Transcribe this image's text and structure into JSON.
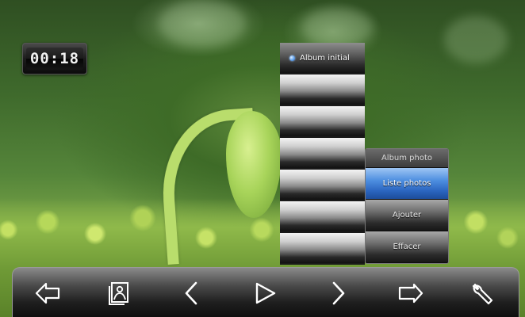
{
  "timer": {
    "display": "00:18"
  },
  "album_menu": {
    "items": [
      {
        "label": "Album initial",
        "selected": true
      },
      {
        "label": ""
      },
      {
        "label": ""
      },
      {
        "label": ""
      },
      {
        "label": ""
      },
      {
        "label": ""
      },
      {
        "label": ""
      }
    ]
  },
  "photo_menu": {
    "header": "Album photo",
    "options": [
      {
        "label": "Liste photos",
        "selected": true
      },
      {
        "label": "Ajouter"
      },
      {
        "label": "Effacer"
      }
    ]
  },
  "toolbar": {
    "buttons": [
      {
        "name": "back",
        "icon": "back-arrow-icon"
      },
      {
        "name": "photo-album",
        "icon": "photo-frame-icon"
      },
      {
        "name": "previous",
        "icon": "chevron-left-icon"
      },
      {
        "name": "play",
        "icon": "play-icon"
      },
      {
        "name": "next",
        "icon": "chevron-right-icon"
      },
      {
        "name": "enter",
        "icon": "forward-arrow-icon"
      },
      {
        "name": "settings",
        "icon": "wrench-icon"
      }
    ]
  },
  "colors": {
    "selection_blue": "#4e8fe0",
    "bullet_blue": "#6ca9ee"
  }
}
